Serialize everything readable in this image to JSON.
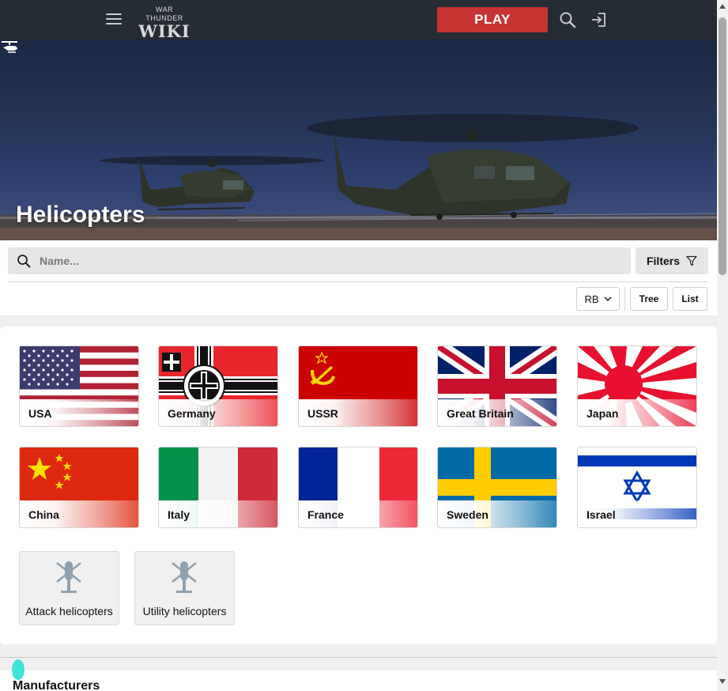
{
  "header": {
    "logo_line1": "WAR THUNDER",
    "logo_line2": "WIKI",
    "play_label": "PLAY",
    "icons": [
      "menu-icon",
      "search-icon",
      "login-icon"
    ],
    "play_color": "#c83434",
    "bar_color": "#262c33"
  },
  "hero": {
    "title": "Helicopters"
  },
  "search": {
    "placeholder": "Name..."
  },
  "toolbar": {
    "filters_label": "Filters",
    "mode_value": "RB",
    "tree_label": "Tree",
    "list_label": "List"
  },
  "countries": [
    {
      "name": "USA",
      "flag": "usa"
    },
    {
      "name": "Germany",
      "flag": "germany"
    },
    {
      "name": "USSR",
      "flag": "ussr"
    },
    {
      "name": "Great Britain",
      "flag": "great-britain"
    },
    {
      "name": "Japan",
      "flag": "japan"
    },
    {
      "name": "China",
      "flag": "china"
    },
    {
      "name": "Italy",
      "flag": "italy"
    },
    {
      "name": "France",
      "flag": "france"
    },
    {
      "name": "Sweden",
      "flag": "sweden"
    },
    {
      "name": "Israel",
      "flag": "israel"
    }
  ],
  "types": [
    {
      "name": "Attack helicopters",
      "icon": "helicopter-icon"
    },
    {
      "name": "Utility helicopters",
      "icon": "helicopter-icon"
    }
  ],
  "sections": {
    "manufacturers": "Manufacturers"
  },
  "colors": {
    "accent_teal": "#3fe5d8"
  }
}
